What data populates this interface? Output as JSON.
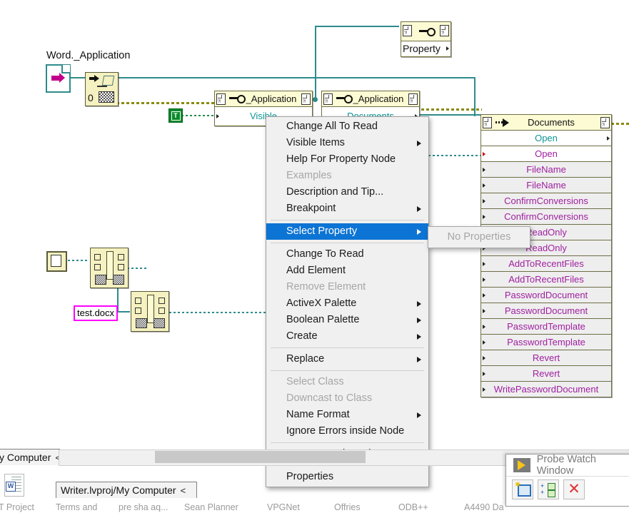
{
  "diagram": {
    "labels": {
      "word_application": "Word._Application",
      "test_docx": "test.docx",
      "bool_true": "T",
      "zero": "0"
    },
    "nodes": [
      {
        "title": "Property",
        "kind": "property-node-fragment"
      },
      {
        "title": "_Application",
        "rows": [
          "Visible"
        ]
      },
      {
        "title": "_Application",
        "rows": [
          "Documents"
        ]
      }
    ],
    "property_list": {
      "header": "Documents",
      "rows": [
        {
          "label": "Open",
          "color": "teal",
          "arrow": "right-edge",
          "bg": "white"
        },
        {
          "label": "Open",
          "color": "purple",
          "arrow": "left-red",
          "bg": "white"
        },
        {
          "label": "FileName",
          "color": "purple",
          "arrow": "left",
          "bg": "gray"
        },
        {
          "label": "FileName",
          "color": "purple",
          "arrow": "left",
          "bg": "gray"
        },
        {
          "label": "ConfirmConversions",
          "color": "purple",
          "arrow": "left",
          "bg": "gray"
        },
        {
          "label": "ConfirmConversions",
          "color": "purple",
          "arrow": "left",
          "bg": "gray"
        },
        {
          "label": "ReadOnly",
          "color": "purple",
          "arrow": "left",
          "bg": "gray"
        },
        {
          "label": "ReadOnly",
          "color": "purple",
          "arrow": "left",
          "bg": "gray"
        },
        {
          "label": "AddToRecentFiles",
          "color": "purple",
          "arrow": "left",
          "bg": "gray"
        },
        {
          "label": "AddToRecentFiles",
          "color": "purple",
          "arrow": "left",
          "bg": "gray"
        },
        {
          "label": "PasswordDocument",
          "color": "purple",
          "arrow": "left",
          "bg": "gray"
        },
        {
          "label": "PasswordDocument",
          "color": "purple",
          "arrow": "left",
          "bg": "gray"
        },
        {
          "label": "PasswordTemplate",
          "color": "purple",
          "arrow": "left",
          "bg": "gray"
        },
        {
          "label": "PasswordTemplate",
          "color": "purple",
          "arrow": "left",
          "bg": "gray"
        },
        {
          "label": "Revert",
          "color": "purple",
          "arrow": "left",
          "bg": "gray"
        },
        {
          "label": "Revert",
          "color": "purple",
          "arrow": "left",
          "bg": "gray"
        },
        {
          "label": "WritePasswordDocument",
          "color": "purple",
          "arrow": "left",
          "bg": "gray"
        }
      ]
    }
  },
  "context_menu": {
    "items": [
      {
        "label": "Change All To Read",
        "enabled": true,
        "submenu": false,
        "selected": false
      },
      {
        "label": "Visible Items",
        "enabled": true,
        "submenu": true,
        "selected": false
      },
      {
        "label": "Help For Property Node",
        "enabled": true,
        "submenu": false,
        "selected": false
      },
      {
        "label": "Examples",
        "enabled": false,
        "submenu": false,
        "selected": false
      },
      {
        "label": "Description and Tip...",
        "enabled": true,
        "submenu": false,
        "selected": false
      },
      {
        "label": "Breakpoint",
        "enabled": true,
        "submenu": true,
        "selected": false
      },
      {
        "separator": true
      },
      {
        "label": "Select Property",
        "enabled": true,
        "submenu": true,
        "selected": true
      },
      {
        "separator": true
      },
      {
        "label": "Change To Read",
        "enabled": true,
        "submenu": false,
        "selected": false
      },
      {
        "label": "Add Element",
        "enabled": true,
        "submenu": false,
        "selected": false
      },
      {
        "label": "Remove Element",
        "enabled": false,
        "submenu": false,
        "selected": false
      },
      {
        "label": "ActiveX Palette",
        "enabled": true,
        "submenu": true,
        "selected": false
      },
      {
        "label": "Boolean Palette",
        "enabled": true,
        "submenu": true,
        "selected": false
      },
      {
        "label": "Create",
        "enabled": true,
        "submenu": true,
        "selected": false
      },
      {
        "separator": true
      },
      {
        "label": "Replace",
        "enabled": true,
        "submenu": true,
        "selected": false
      },
      {
        "separator": true
      },
      {
        "label": "Select Class",
        "enabled": false,
        "submenu": false,
        "selected": false
      },
      {
        "label": "Downcast to Class",
        "enabled": false,
        "submenu": false,
        "selected": false
      },
      {
        "label": "Name Format",
        "enabled": true,
        "submenu": true,
        "selected": false
      },
      {
        "label": "Ignore Errors inside Node",
        "enabled": true,
        "submenu": false,
        "selected": false
      },
      {
        "separator": true
      },
      {
        "label": "Remove and Rewire",
        "enabled": true,
        "submenu": false,
        "selected": false
      },
      {
        "separator": true
      },
      {
        "label": "Properties",
        "enabled": true,
        "submenu": false,
        "selected": false
      }
    ],
    "submenu": {
      "items": [
        {
          "label": "No Properties",
          "enabled": false
        }
      ]
    }
  },
  "window_bars": {
    "my_computer": "y Computer",
    "my_computer_chevron": "<",
    "project_path": "Writer.lvproj/My Computer",
    "project_path_chevron": "<"
  },
  "probe_window": {
    "title": "Probe Watch Window",
    "tools": [
      "new-probe",
      "update-probes",
      "delete-probe"
    ]
  },
  "taskbar": {
    "items": [
      "T Project",
      "Terms and",
      "pre sha aq...",
      "Sean Planner",
      "VPGNet",
      "Offries",
      "ODB++",
      "A4490 Da"
    ]
  },
  "colors": {
    "menu_highlight": "#0c74d4",
    "node_background": "#fdfbd3",
    "wire_teal": "#2e8b8b",
    "property_purple": "#a020a0",
    "method_teal": "#0f9494",
    "constant_magenta": "#ff00ff",
    "boolean_green": "#0a8a2a"
  }
}
